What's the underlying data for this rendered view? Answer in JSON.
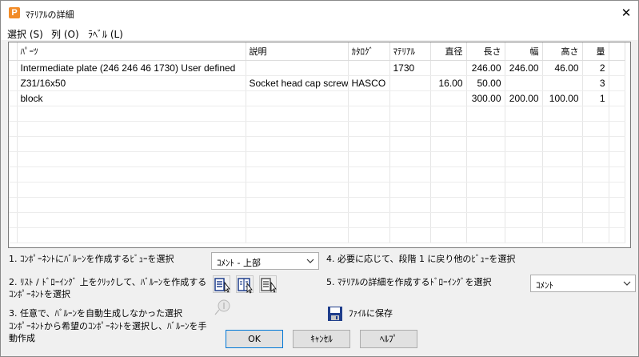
{
  "window": {
    "title": "ﾏﾃﾘｱﾙの詳細",
    "app_icon_letter": "P",
    "close_glyph": "✕"
  },
  "menu": {
    "items": [
      "選択 (S)",
      "列 (O)",
      "ﾗﾍﾞﾙ (L)"
    ]
  },
  "table": {
    "headers": [
      "ﾊﾟｰﾂ",
      "説明",
      "ｶﾀﾛｸﾞ",
      "ﾏﾃﾘｱﾙ",
      "直径",
      "長さ",
      "幅",
      "高さ",
      "量"
    ],
    "rows": [
      [
        "Intermediate plate (246 246 46 1730) User defined",
        "",
        "",
        "1730",
        "",
        "246.00",
        "246.00",
        "46.00",
        "2"
      ],
      [
        "Z31/16x50",
        "Socket head cap screw",
        "HASCO",
        "",
        "16.00",
        "50.00",
        "",
        "",
        "3"
      ],
      [
        "block",
        "",
        "",
        "",
        "",
        "300.00",
        "200.00",
        "100.00",
        "1"
      ]
    ]
  },
  "steps": {
    "step1": "1. ｺﾝﾎﾟｰﾈﾝﾄにﾊﾞﾙｰﾝを作成するﾋﾞｭｰを選択",
    "step2_line1": "2. ﾘｽﾄ / ﾄﾞﾛｰｲﾝｸﾞ 上をｸﾘｯｸして、ﾊﾞﾙｰﾝを作成する",
    "step2_line2": "ｺﾝﾎﾟｰﾈﾝﾄを選択",
    "step3_line1": "3. 任意で、ﾊﾞﾙｰﾝを自動生成しなかった選択",
    "step3_line2": "ｺﾝﾎﾟｰﾈﾝﾄから希望のｺﾝﾎﾟｰﾈﾝﾄを選択し、ﾊﾞﾙｰﾝを手",
    "step3_line3": "動作成",
    "step4": "4. 必要に応じて、段階 1 に戻り他のﾋﾞｭｰを選択",
    "step5": "5. ﾏﾃﾘｱﾙの詳細を作成するﾄﾞﾛｰｲﾝｸﾞを選択"
  },
  "view_select": {
    "value": "ｺﾒﾝﾄ - 上部"
  },
  "drawing_select": {
    "value": "ｺﾒﾝﾄ"
  },
  "save_label": "ﾌｧｲﾙに保存",
  "buttons": {
    "ok": "OK",
    "cancel": "ｷｬﾝｾﾙ",
    "help": "ﾍﾙﾌﾟ"
  },
  "colors": {
    "accent": "#0078d7",
    "app_icon": "#f28c28",
    "icon_blue": "#1f3e8c"
  }
}
